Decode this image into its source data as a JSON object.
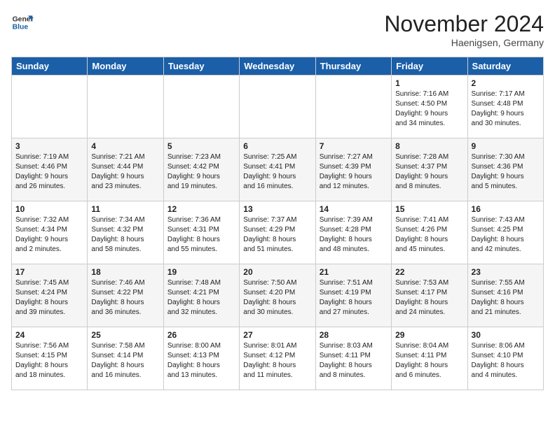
{
  "logo": {
    "line1": "General",
    "line2": "Blue"
  },
  "title": "November 2024",
  "location": "Haenigsen, Germany",
  "weekdays": [
    "Sunday",
    "Monday",
    "Tuesday",
    "Wednesday",
    "Thursday",
    "Friday",
    "Saturday"
  ],
  "weeks": [
    [
      {
        "day": "",
        "info": ""
      },
      {
        "day": "",
        "info": ""
      },
      {
        "day": "",
        "info": ""
      },
      {
        "day": "",
        "info": ""
      },
      {
        "day": "",
        "info": ""
      },
      {
        "day": "1",
        "info": "Sunrise: 7:16 AM\nSunset: 4:50 PM\nDaylight: 9 hours\nand 34 minutes."
      },
      {
        "day": "2",
        "info": "Sunrise: 7:17 AM\nSunset: 4:48 PM\nDaylight: 9 hours\nand 30 minutes."
      }
    ],
    [
      {
        "day": "3",
        "info": "Sunrise: 7:19 AM\nSunset: 4:46 PM\nDaylight: 9 hours\nand 26 minutes."
      },
      {
        "day": "4",
        "info": "Sunrise: 7:21 AM\nSunset: 4:44 PM\nDaylight: 9 hours\nand 23 minutes."
      },
      {
        "day": "5",
        "info": "Sunrise: 7:23 AM\nSunset: 4:42 PM\nDaylight: 9 hours\nand 19 minutes."
      },
      {
        "day": "6",
        "info": "Sunrise: 7:25 AM\nSunset: 4:41 PM\nDaylight: 9 hours\nand 16 minutes."
      },
      {
        "day": "7",
        "info": "Sunrise: 7:27 AM\nSunset: 4:39 PM\nDaylight: 9 hours\nand 12 minutes."
      },
      {
        "day": "8",
        "info": "Sunrise: 7:28 AM\nSunset: 4:37 PM\nDaylight: 9 hours\nand 8 minutes."
      },
      {
        "day": "9",
        "info": "Sunrise: 7:30 AM\nSunset: 4:36 PM\nDaylight: 9 hours\nand 5 minutes."
      }
    ],
    [
      {
        "day": "10",
        "info": "Sunrise: 7:32 AM\nSunset: 4:34 PM\nDaylight: 9 hours\nand 2 minutes."
      },
      {
        "day": "11",
        "info": "Sunrise: 7:34 AM\nSunset: 4:32 PM\nDaylight: 8 hours\nand 58 minutes."
      },
      {
        "day": "12",
        "info": "Sunrise: 7:36 AM\nSunset: 4:31 PM\nDaylight: 8 hours\nand 55 minutes."
      },
      {
        "day": "13",
        "info": "Sunrise: 7:37 AM\nSunset: 4:29 PM\nDaylight: 8 hours\nand 51 minutes."
      },
      {
        "day": "14",
        "info": "Sunrise: 7:39 AM\nSunset: 4:28 PM\nDaylight: 8 hours\nand 48 minutes."
      },
      {
        "day": "15",
        "info": "Sunrise: 7:41 AM\nSunset: 4:26 PM\nDaylight: 8 hours\nand 45 minutes."
      },
      {
        "day": "16",
        "info": "Sunrise: 7:43 AM\nSunset: 4:25 PM\nDaylight: 8 hours\nand 42 minutes."
      }
    ],
    [
      {
        "day": "17",
        "info": "Sunrise: 7:45 AM\nSunset: 4:24 PM\nDaylight: 8 hours\nand 39 minutes."
      },
      {
        "day": "18",
        "info": "Sunrise: 7:46 AM\nSunset: 4:22 PM\nDaylight: 8 hours\nand 36 minutes."
      },
      {
        "day": "19",
        "info": "Sunrise: 7:48 AM\nSunset: 4:21 PM\nDaylight: 8 hours\nand 32 minutes."
      },
      {
        "day": "20",
        "info": "Sunrise: 7:50 AM\nSunset: 4:20 PM\nDaylight: 8 hours\nand 30 minutes."
      },
      {
        "day": "21",
        "info": "Sunrise: 7:51 AM\nSunset: 4:19 PM\nDaylight: 8 hours\nand 27 minutes."
      },
      {
        "day": "22",
        "info": "Sunrise: 7:53 AM\nSunset: 4:17 PM\nDaylight: 8 hours\nand 24 minutes."
      },
      {
        "day": "23",
        "info": "Sunrise: 7:55 AM\nSunset: 4:16 PM\nDaylight: 8 hours\nand 21 minutes."
      }
    ],
    [
      {
        "day": "24",
        "info": "Sunrise: 7:56 AM\nSunset: 4:15 PM\nDaylight: 8 hours\nand 18 minutes."
      },
      {
        "day": "25",
        "info": "Sunrise: 7:58 AM\nSunset: 4:14 PM\nDaylight: 8 hours\nand 16 minutes."
      },
      {
        "day": "26",
        "info": "Sunrise: 8:00 AM\nSunset: 4:13 PM\nDaylight: 8 hours\nand 13 minutes."
      },
      {
        "day": "27",
        "info": "Sunrise: 8:01 AM\nSunset: 4:12 PM\nDaylight: 8 hours\nand 11 minutes."
      },
      {
        "day": "28",
        "info": "Sunrise: 8:03 AM\nSunset: 4:11 PM\nDaylight: 8 hours\nand 8 minutes."
      },
      {
        "day": "29",
        "info": "Sunrise: 8:04 AM\nSunset: 4:11 PM\nDaylight: 8 hours\nand 6 minutes."
      },
      {
        "day": "30",
        "info": "Sunrise: 8:06 AM\nSunset: 4:10 PM\nDaylight: 8 hours\nand 4 minutes."
      }
    ]
  ]
}
